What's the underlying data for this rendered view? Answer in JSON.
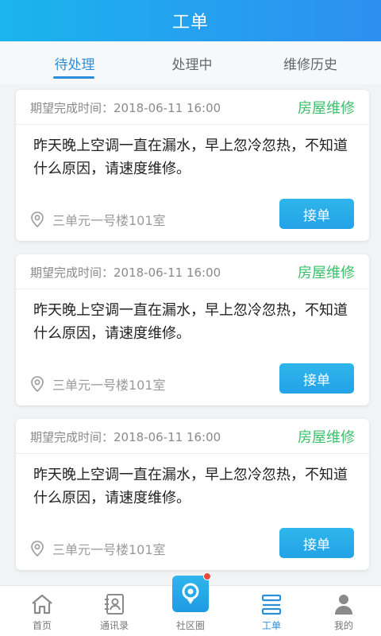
{
  "header": {
    "title": "工单"
  },
  "tabs": [
    {
      "label": "待处理",
      "active": true
    },
    {
      "label": "处理中",
      "active": false
    },
    {
      "label": "维修历史",
      "active": false
    }
  ],
  "orders": [
    {
      "expect_label": "期望完成时间：2018-06-11 16:00",
      "category": "房屋维修",
      "description": "昨天晚上空调一直在漏水，早上忽冷忽热，不知道什么原因，请速度维修。",
      "address": "三单元一号楼101室",
      "accept_label": "接单"
    },
    {
      "expect_label": "期望完成时间：2018-06-11 16:00",
      "category": "房屋维修",
      "description": "昨天晚上空调一直在漏水，早上忽冷忽热，不知道什么原因，请速度维修。",
      "address": "三单元一号楼101室",
      "accept_label": "接单"
    },
    {
      "expect_label": "期望完成时间：2018-06-11 16:00",
      "category": "房屋维修",
      "description": "昨天晚上空调一直在漏水，早上忽冷忽热，不知道什么原因，请速度维修。",
      "address": "三单元一号楼101室",
      "accept_label": "接单"
    }
  ],
  "tabbar": {
    "items": [
      {
        "label": "首页",
        "icon": "home-icon"
      },
      {
        "label": "通讯录",
        "icon": "contacts-icon"
      },
      {
        "label": "社区圈",
        "icon": "community-icon"
      },
      {
        "label": "工单",
        "icon": "work-order-icon",
        "active": true
      },
      {
        "label": "我的",
        "icon": "profile-icon"
      }
    ]
  },
  "colors": {
    "header_start": "#1bb4ee",
    "header_end": "#2d8ff0",
    "accent": "#2a8fd8",
    "category": "#3cc06a",
    "badge": "#f04a3c"
  }
}
